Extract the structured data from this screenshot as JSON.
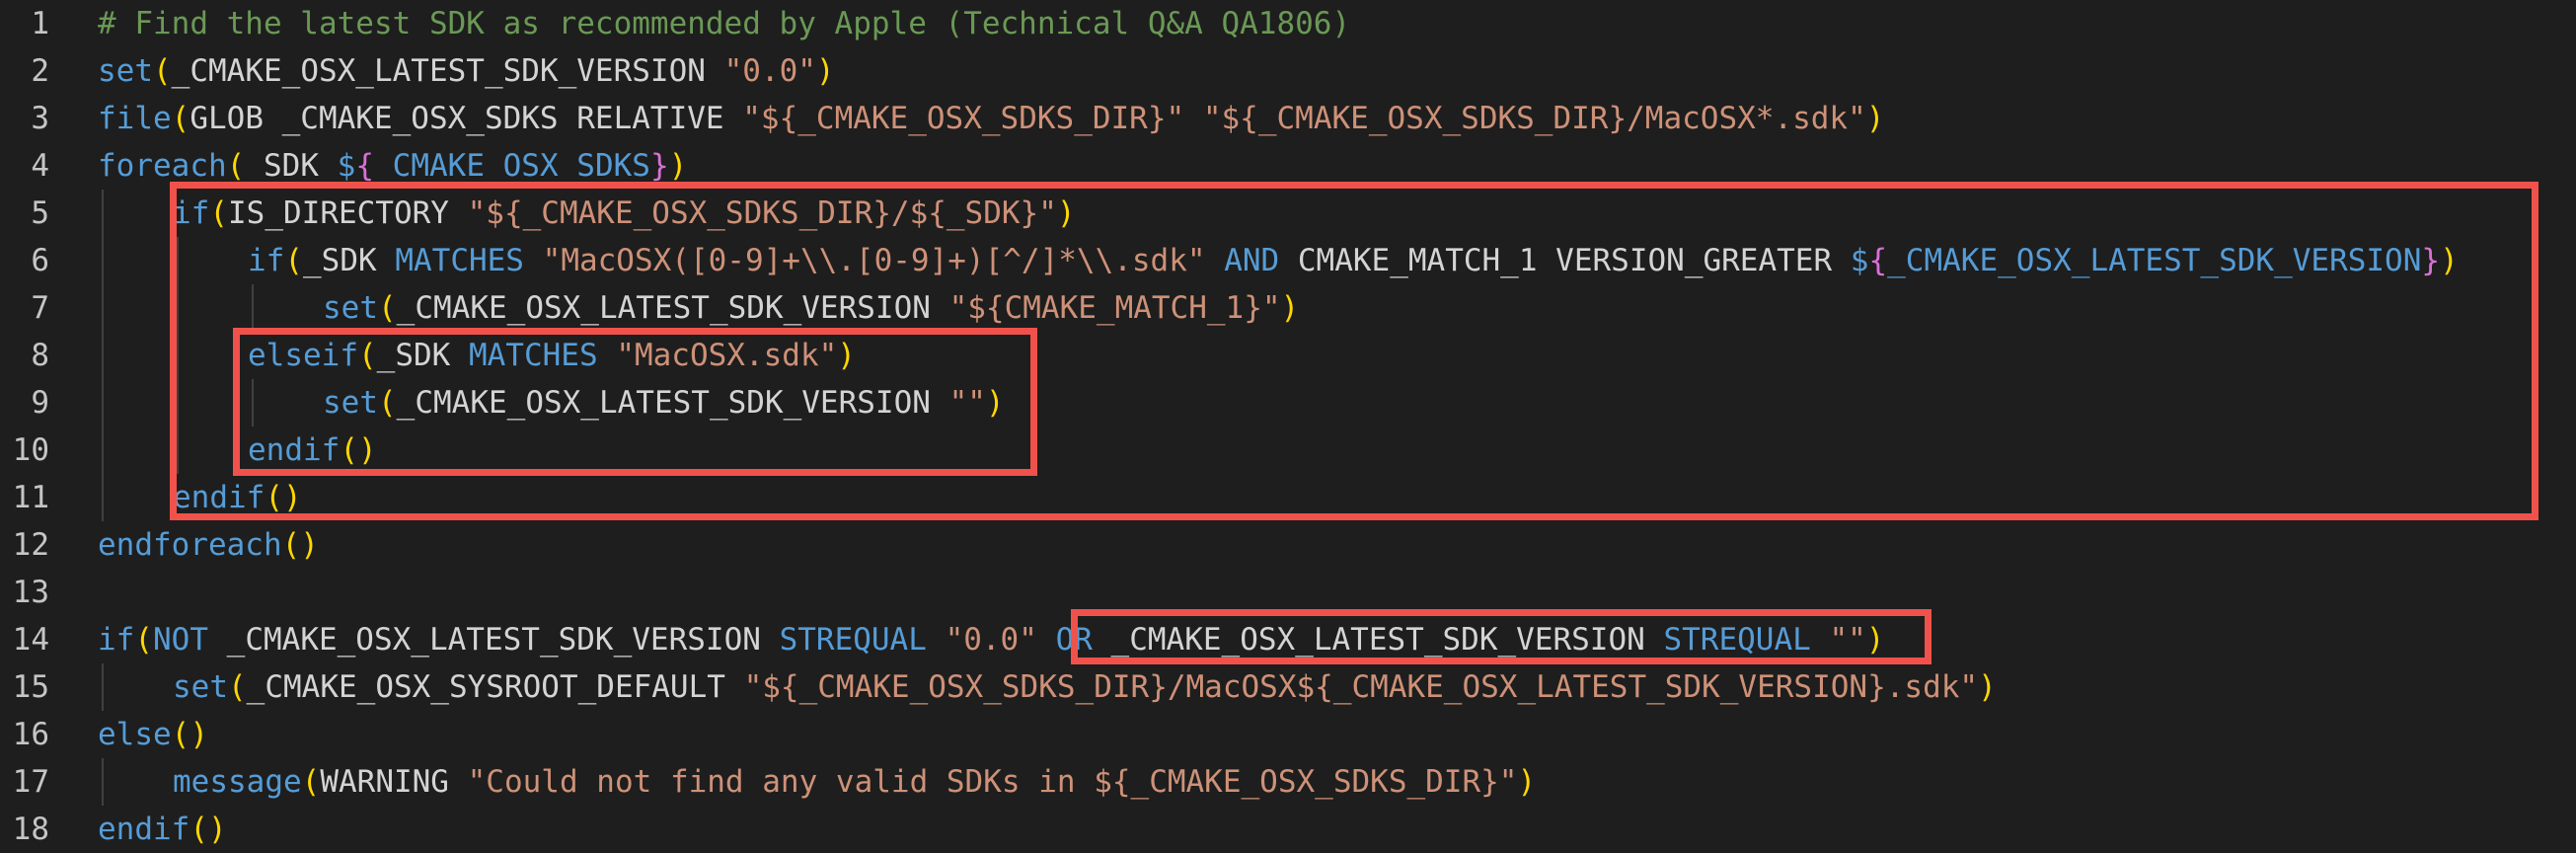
{
  "editor": {
    "lines": [
      {
        "n": "1",
        "indent": 0,
        "tokens": [
          {
            "t": "# Find the latest SDK as recommended by Apple (Technical Q&A QA1806)",
            "c": "cmt"
          }
        ]
      },
      {
        "n": "2",
        "indent": 0,
        "tokens": [
          {
            "t": "set",
            "c": "kw"
          },
          {
            "t": "(",
            "c": "p1"
          },
          {
            "t": "_CMAKE_OSX_LATEST_SDK_VERSION ",
            "c": "txt"
          },
          {
            "t": "\"0.0\"",
            "c": "str"
          },
          {
            "t": ")",
            "c": "p1"
          }
        ]
      },
      {
        "n": "3",
        "indent": 0,
        "tokens": [
          {
            "t": "file",
            "c": "kw"
          },
          {
            "t": "(",
            "c": "p1"
          },
          {
            "t": "GLOB _CMAKE_OSX_SDKS RELATIVE ",
            "c": "txt"
          },
          {
            "t": "\"${_CMAKE_OSX_SDKS_DIR}\"",
            "c": "str"
          },
          {
            "t": " ",
            "c": "txt"
          },
          {
            "t": "\"${_CMAKE_OSX_SDKS_DIR}/MacOSX*.sdk\"",
            "c": "str"
          },
          {
            "t": ")",
            "c": "p1"
          }
        ]
      },
      {
        "n": "4",
        "indent": 0,
        "tokens": [
          {
            "t": "foreach",
            "c": "kw"
          },
          {
            "t": "(",
            "c": "p1"
          },
          {
            "t": "_SDK ",
            "c": "txt"
          },
          {
            "t": "$",
            "c": "var"
          },
          {
            "t": "{",
            "c": "p2"
          },
          {
            "t": "_CMAKE_OSX_SDKS",
            "c": "var"
          },
          {
            "t": "}",
            "c": "p2"
          },
          {
            "t": ")",
            "c": "p1"
          }
        ]
      },
      {
        "n": "5",
        "indent": 1,
        "tokens": [
          {
            "t": "if",
            "c": "kw"
          },
          {
            "t": "(",
            "c": "p1"
          },
          {
            "t": "IS_DIRECTORY ",
            "c": "txt"
          },
          {
            "t": "\"${_CMAKE_OSX_SDKS_DIR}/${_SDK}\"",
            "c": "str"
          },
          {
            "t": ")",
            "c": "p1"
          }
        ]
      },
      {
        "n": "6",
        "indent": 2,
        "tokens": [
          {
            "t": "if",
            "c": "kw"
          },
          {
            "t": "(",
            "c": "p1"
          },
          {
            "t": "_SDK ",
            "c": "txt"
          },
          {
            "t": "MATCHES",
            "c": "op"
          },
          {
            "t": " ",
            "c": "txt"
          },
          {
            "t": "\"MacOSX([0-9]+\\\\.[0-9]+)[^/]*\\\\.sdk\"",
            "c": "str"
          },
          {
            "t": " ",
            "c": "txt"
          },
          {
            "t": "AND",
            "c": "op"
          },
          {
            "t": " CMAKE_MATCH_1 VERSION_GREATER ",
            "c": "txt"
          },
          {
            "t": "$",
            "c": "var"
          },
          {
            "t": "{",
            "c": "p2"
          },
          {
            "t": "_CMAKE_OSX_LATEST_SDK_VERSION",
            "c": "var"
          },
          {
            "t": "}",
            "c": "p2"
          },
          {
            "t": ")",
            "c": "p1"
          }
        ]
      },
      {
        "n": "7",
        "indent": 3,
        "tokens": [
          {
            "t": "set",
            "c": "kw"
          },
          {
            "t": "(",
            "c": "p1"
          },
          {
            "t": "_CMAKE_OSX_LATEST_SDK_VERSION ",
            "c": "txt"
          },
          {
            "t": "\"${CMAKE_MATCH_1}\"",
            "c": "str"
          },
          {
            "t": ")",
            "c": "p1"
          }
        ]
      },
      {
        "n": "8",
        "indent": 2,
        "tokens": [
          {
            "t": "elseif",
            "c": "kw"
          },
          {
            "t": "(",
            "c": "p1"
          },
          {
            "t": "_SDK ",
            "c": "txt"
          },
          {
            "t": "MATCHES",
            "c": "op"
          },
          {
            "t": " ",
            "c": "txt"
          },
          {
            "t": "\"MacOSX.sdk\"",
            "c": "str"
          },
          {
            "t": ")",
            "c": "p1"
          }
        ]
      },
      {
        "n": "9",
        "indent": 3,
        "tokens": [
          {
            "t": "set",
            "c": "kw"
          },
          {
            "t": "(",
            "c": "p1"
          },
          {
            "t": "_CMAKE_OSX_LATEST_SDK_VERSION ",
            "c": "txt"
          },
          {
            "t": "\"\"",
            "c": "str"
          },
          {
            "t": ")",
            "c": "p1"
          }
        ]
      },
      {
        "n": "10",
        "indent": 2,
        "tokens": [
          {
            "t": "endif",
            "c": "kw"
          },
          {
            "t": "()",
            "c": "p1"
          }
        ]
      },
      {
        "n": "11",
        "indent": 1,
        "tokens": [
          {
            "t": "endif",
            "c": "kw"
          },
          {
            "t": "()",
            "c": "p1"
          }
        ]
      },
      {
        "n": "12",
        "indent": 0,
        "tokens": [
          {
            "t": "endforeach",
            "c": "kw"
          },
          {
            "t": "()",
            "c": "p1"
          }
        ]
      },
      {
        "n": "13",
        "indent": 0,
        "tokens": []
      },
      {
        "n": "14",
        "indent": 0,
        "tokens": [
          {
            "t": "if",
            "c": "kw"
          },
          {
            "t": "(",
            "c": "p1"
          },
          {
            "t": "NOT",
            "c": "op"
          },
          {
            "t": " _CMAKE_OSX_LATEST_SDK_VERSION ",
            "c": "txt"
          },
          {
            "t": "STREQUAL",
            "c": "op"
          },
          {
            "t": " ",
            "c": "txt"
          },
          {
            "t": "\"0.0\"",
            "c": "str"
          },
          {
            "t": " ",
            "c": "txt"
          },
          {
            "t": "OR",
            "c": "op"
          },
          {
            "t": " _CMAKE_OSX_LATEST_SDK_VERSION ",
            "c": "txt"
          },
          {
            "t": "STREQUAL",
            "c": "op"
          },
          {
            "t": " ",
            "c": "txt"
          },
          {
            "t": "\"\"",
            "c": "str"
          },
          {
            "t": ")",
            "c": "p1"
          }
        ]
      },
      {
        "n": "15",
        "indent": 1,
        "tokens": [
          {
            "t": "set",
            "c": "kw"
          },
          {
            "t": "(",
            "c": "p1"
          },
          {
            "t": "_CMAKE_OSX_SYSROOT_DEFAULT ",
            "c": "txt"
          },
          {
            "t": "\"${_CMAKE_OSX_SDKS_DIR}/MacOSX${_CMAKE_OSX_LATEST_SDK_VERSION}.sdk\"",
            "c": "str"
          },
          {
            "t": ")",
            "c": "p1"
          }
        ]
      },
      {
        "n": "16",
        "indent": 0,
        "tokens": [
          {
            "t": "else",
            "c": "kw"
          },
          {
            "t": "()",
            "c": "p1"
          }
        ]
      },
      {
        "n": "17",
        "indent": 1,
        "tokens": [
          {
            "t": "message",
            "c": "kw"
          },
          {
            "t": "(",
            "c": "p1"
          },
          {
            "t": "WARNING ",
            "c": "txt"
          },
          {
            "t": "\"Could not find any valid SDKs in ${_CMAKE_OSX_SDKS_DIR}\"",
            "c": "str"
          },
          {
            "t": ")",
            "c": "p1"
          }
        ]
      },
      {
        "n": "18",
        "indent": 0,
        "tokens": [
          {
            "t": "endif",
            "c": "kw"
          },
          {
            "t": "()",
            "c": "p1"
          }
        ]
      }
    ]
  },
  "annotations": {
    "color": "#f0524b",
    "boxes": [
      "outer-if-block",
      "elseif-block",
      "or-condition"
    ]
  },
  "theme": {
    "background": "#1e1e1e",
    "comment": "#6a9955",
    "keyword": "#569cd6",
    "string": "#ce9178",
    "bracket_1": "#ffd700",
    "bracket_2": "#da70d6",
    "text": "#d4d4d4",
    "line_number": "#c5c5c5"
  }
}
